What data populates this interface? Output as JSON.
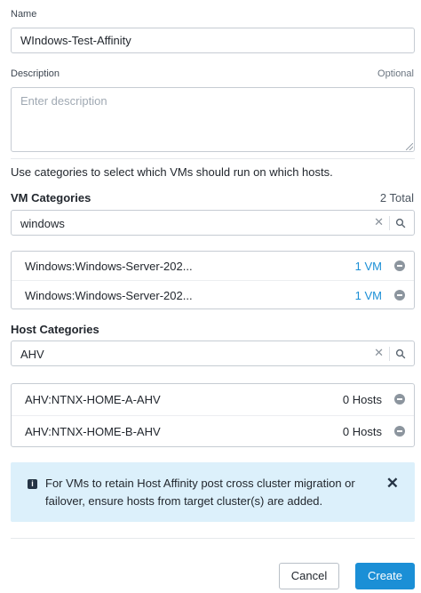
{
  "name_field": {
    "label": "Name",
    "value": "WIndows-Test-Affinity"
  },
  "description_field": {
    "label": "Description",
    "optional_label": "Optional",
    "placeholder": "Enter description"
  },
  "helper_text": "Use categories to select which VMs should run on which hosts.",
  "vm_categories": {
    "title": "VM Categories",
    "total": "2 Total",
    "search_value": "windows",
    "items": [
      {
        "name": "Windows:Windows-Server-202...",
        "count": "1 VM"
      },
      {
        "name": "Windows:Windows-Server-202...",
        "count": "1 VM"
      }
    ]
  },
  "host_categories": {
    "title": "Host Categories",
    "search_value": "AHV",
    "items": [
      {
        "name": "AHV:NTNX-HOME-A-AHV",
        "count": "0 Hosts"
      },
      {
        "name": "AHV:NTNX-HOME-B-AHV",
        "count": "0 Hosts"
      }
    ]
  },
  "info_banner": {
    "message": "For VMs to retain Host Affinity post cross cluster migration or failover, ensure hosts from target cluster(s) are added."
  },
  "buttons": {
    "cancel": "Cancel",
    "create": "Create"
  },
  "icons": {
    "clear": "close-icon",
    "search": "search-icon",
    "remove": "remove-circle-icon",
    "info": "info-icon",
    "banner_close": "close-icon"
  },
  "colors": {
    "accent": "#1b8fd6",
    "banner_bg": "#dcf0fb"
  }
}
